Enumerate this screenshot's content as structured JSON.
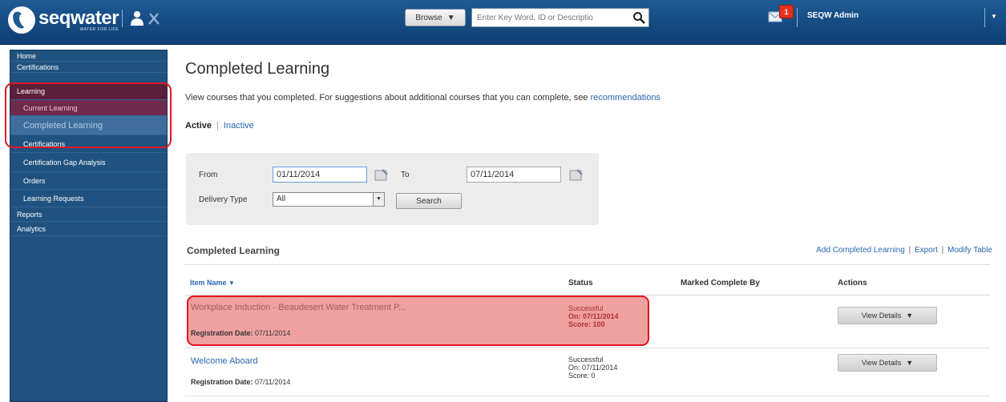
{
  "header": {
    "logo_text": "seqwater",
    "logo_tagline": "WATER FOR LIFE",
    "browse_label": "Browse",
    "search_placeholder": "Enter Key Word, ID or Descriptio",
    "notification_count": "1",
    "user_name": "SEQW Admin"
  },
  "sidebar": {
    "items": [
      {
        "label": "Home"
      },
      {
        "label": "Certifications"
      },
      {
        "label": "Learning"
      },
      {
        "label": "Current Learning"
      },
      {
        "label": "Completed Learning"
      },
      {
        "label": "Certifications"
      },
      {
        "label": "Certification Gap Analysis"
      },
      {
        "label": "Orders"
      },
      {
        "label": "Learning Requests"
      },
      {
        "label": "Reports"
      },
      {
        "label": "Analytics"
      }
    ]
  },
  "main": {
    "title": "Completed Learning",
    "intro_text": "View courses that you completed. For suggestions about additional courses that you can complete, see",
    "intro_link": "recommendations",
    "tabs": {
      "active": "Active",
      "separator": "|",
      "inactive": "Inactive"
    },
    "filter": {
      "from_label": "From",
      "from_value": "01/11/2014",
      "to_label": "To",
      "to_value": "07/11/2014",
      "delivery_label": "Delivery Type",
      "delivery_value": "All",
      "search_label": "Search"
    },
    "section": {
      "title": "Completed Learning",
      "add_link": "Add Completed Learning",
      "export_link": "Export",
      "modify_link": "Modify Table",
      "separator": "|"
    },
    "table": {
      "headers": {
        "item": "Item Name",
        "status": "Status",
        "marked": "Marked Complete By",
        "actions": "Actions"
      },
      "rows": [
        {
          "name": "Workplace Induction - Beaudesert Water Treatment P...",
          "reg_label": "Registration Date:",
          "reg_date": "07/11/2014",
          "status": "Successful",
          "status_on": "On: 07/11/2014",
          "status_score": "Score: 100",
          "action": "View Details"
        },
        {
          "name": "Welcome Aboard",
          "reg_label": "Registration Date:",
          "reg_date": "07/11/2014",
          "status": "Successful",
          "status_on": "On: 07/11/2014",
          "status_score": "Score: 0",
          "action": "View Details"
        }
      ]
    }
  },
  "colors": {
    "accent": "#1f5a94",
    "link": "#2a65b0",
    "highlight": "#e1161f"
  }
}
